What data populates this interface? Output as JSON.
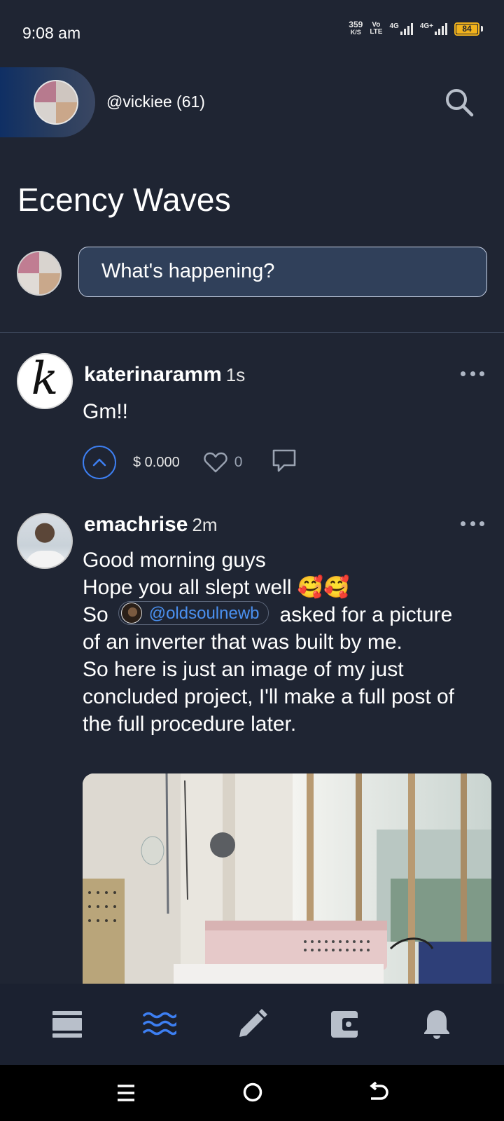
{
  "status_bar": {
    "time": "9:08 am",
    "net_speed": "359",
    "net_unit": "K/S",
    "volte_top": "Vo",
    "volte_bottom": "LTE",
    "network_1": "4G",
    "network_2": "4G+",
    "battery": "84",
    "battery_color": "#f1b21c"
  },
  "header": {
    "username": "@vickiee (61)",
    "search_icon": "search-icon"
  },
  "page": {
    "title": "Ecency Waves"
  },
  "compose": {
    "placeholder": "What's happening?"
  },
  "posts": [
    {
      "author": "katerinaramm",
      "time": "1s",
      "avatar_letter": "k",
      "body": "Gm!!",
      "payout": "$ 0.000",
      "likes": "0"
    },
    {
      "author": "emachrise",
      "time": "2m",
      "line1": "Good morning guys",
      "line2": "Hope you all slept well",
      "line2_emoji": "🥰🥰",
      "line3_prefix": "So",
      "mention": "@oldsoulnewb",
      "line3_suffix": "asked for a picture",
      "line4": "of an inverter that was built by me.",
      "line5": "So here is just an image of my just",
      "line6": "concluded project, I'll make a full post of",
      "line7": "the full procedure later."
    }
  ],
  "bottom_nav": {
    "items": [
      "feed-icon",
      "waves-icon",
      "edit-icon",
      "wallet-icon",
      "bell-icon"
    ],
    "active": "waves-icon",
    "active_color": "#3d7ff2"
  },
  "colors": {
    "background": "#1f2533",
    "accent": "#3d7ff2",
    "mention": "#4a90f0"
  }
}
